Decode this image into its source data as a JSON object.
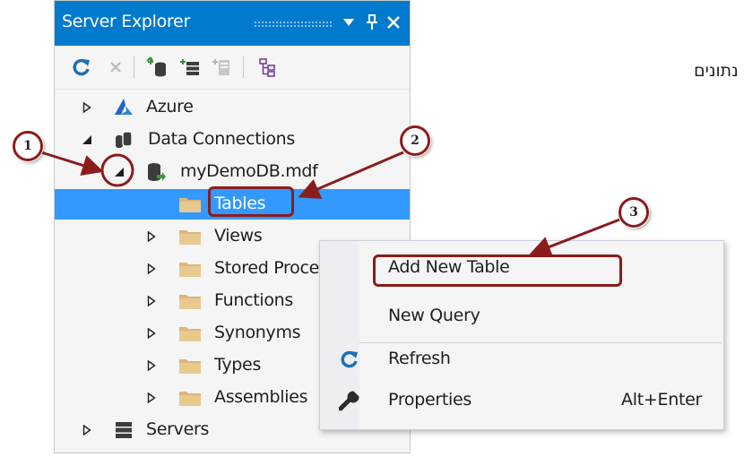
{
  "panel": {
    "title": "Server Explorer",
    "dropdown_icon": "triangle-down-icon",
    "pin_icon": "pin-icon",
    "close_icon": "close-icon"
  },
  "toolbar": {
    "buttons": [
      "refresh-icon",
      "stop-icon",
      "connect-to-database-icon",
      "connect-to-server-icon",
      "connect-to-sharepoint-icon",
      "object-browser-icon"
    ]
  },
  "tree": {
    "azure": "Azure",
    "data_connections": "Data Connections",
    "database": "myDemoDB.mdf",
    "tables": "Tables",
    "views": "Views",
    "stored_procedures": "Stored Procedures",
    "functions": "Functions",
    "synonyms": "Synonyms",
    "types": "Types",
    "assemblies": "Assemblies",
    "servers": "Servers"
  },
  "context_menu": {
    "add_new_table": "Add New Table",
    "new_query": "New Query",
    "refresh": "Refresh",
    "properties": "Properties",
    "properties_shortcut": "Alt+Enter"
  },
  "annotations": {
    "callout_1": "1",
    "callout_2": "2",
    "callout_3": "3",
    "background_text": "נתונים",
    "accent_color": "#8b1c1c"
  },
  "colors": {
    "title_bar": "#007acc",
    "selection": "#3399ff",
    "folder": "#dcb67a"
  }
}
